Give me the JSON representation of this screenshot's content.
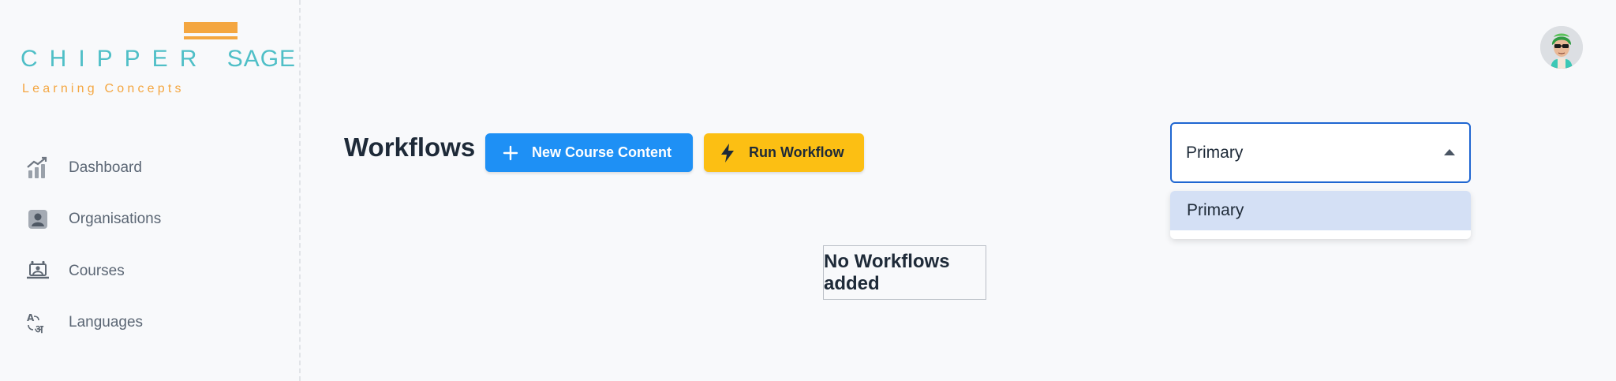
{
  "logo": {
    "main": "CHIPPER",
    "main2": "SAGE",
    "sub": "Learning Concepts"
  },
  "sidebar": {
    "items": [
      {
        "label": "Dashboard",
        "icon": "chart-growth-icon"
      },
      {
        "label": "Organisations",
        "icon": "id-badge-icon"
      },
      {
        "label": "Courses",
        "icon": "laptop-course-icon"
      },
      {
        "label": "Languages",
        "icon": "translate-icon"
      }
    ]
  },
  "header": {
    "title": "Workflows"
  },
  "toolbar": {
    "new_label": "New Course Content",
    "run_label": "Run Workflow"
  },
  "workflow_select": {
    "value": "Primary",
    "options": [
      "Primary"
    ]
  },
  "empty_state": {
    "message": "No Workflows added"
  },
  "colors": {
    "primary": "#1e90f5",
    "accent": "#fcbf13",
    "logo_teal": "#4fbfc7",
    "logo_orange": "#f4a640",
    "select_border": "#1f66d1",
    "option_highlight": "#d4e0f5"
  }
}
